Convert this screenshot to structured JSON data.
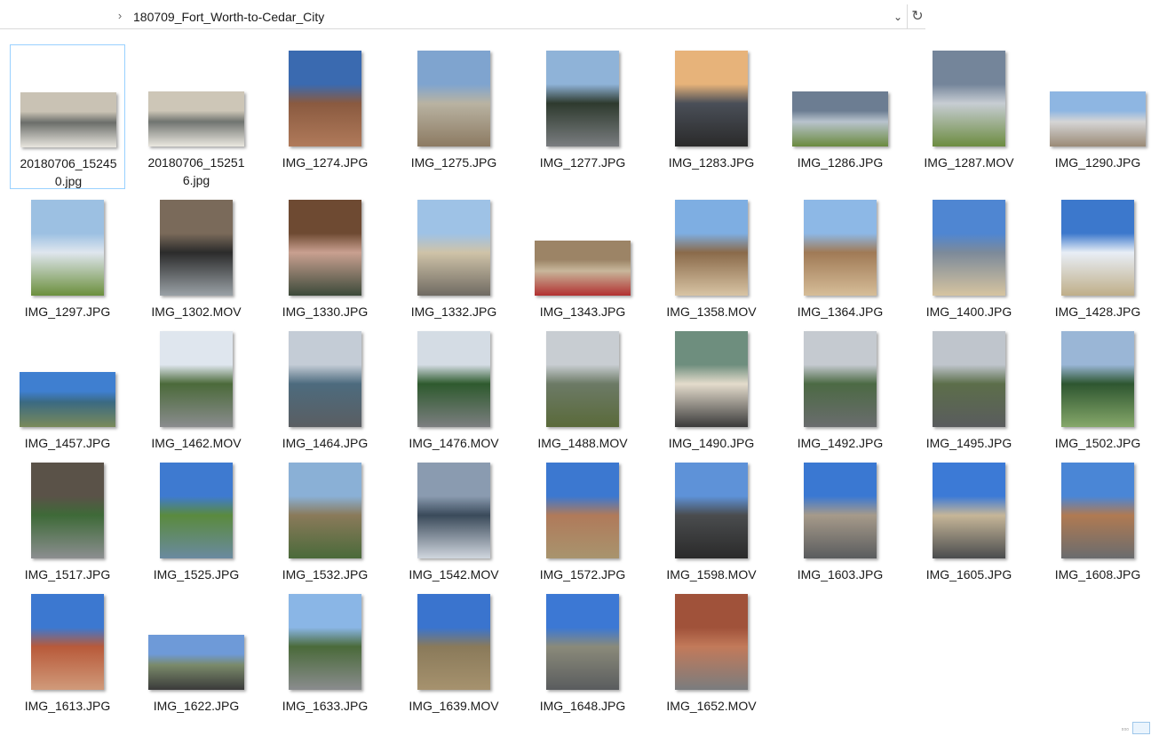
{
  "address_bar": {
    "path": "180709_Fort_Worth-to-Cedar_City",
    "chevron": "›",
    "dropdown": "⌄",
    "refresh": "↻"
  },
  "status": {
    "view_toggle": "▫▫▫"
  },
  "files": [
    {
      "name": "20180706_152450.jpg",
      "orient": "land",
      "colors": [
        "#c9c2b4",
        "#6b6e6a",
        "#e9e6df"
      ]
    },
    {
      "name": "20180706_152516.jpg",
      "orient": "land",
      "colors": [
        "#cdc6b7",
        "#707470",
        "#ebe8e0"
      ]
    },
    {
      "name": "IMG_1274.JPG",
      "orient": "port",
      "colors": [
        "#3a6ab0",
        "#8a5a40",
        "#b07a5a"
      ]
    },
    {
      "name": "IMG_1275.JPG",
      "orient": "port",
      "colors": [
        "#7fa4cf",
        "#b9b3a2",
        "#8c7a62"
      ]
    },
    {
      "name": "IMG_1277.JPG",
      "orient": "port",
      "colors": [
        "#8fb3d8",
        "#2e3a2e",
        "#7a7d80"
      ]
    },
    {
      "name": "IMG_1283.JPG",
      "orient": "port",
      "colors": [
        "#e7b37a",
        "#4a4f58",
        "#2a2a2a"
      ]
    },
    {
      "name": "IMG_1286.JPG",
      "orient": "land",
      "colors": [
        "#6c7d92",
        "#b8c3cd",
        "#6a8a3e"
      ]
    },
    {
      "name": "IMG_1287.MOV",
      "orient": "port",
      "colors": [
        "#74859a",
        "#c7cdd3",
        "#6c8c40"
      ]
    },
    {
      "name": "IMG_1290.JPG",
      "orient": "land",
      "colors": [
        "#8eb6e2",
        "#d5d5d5",
        "#9a8a76"
      ]
    },
    {
      "name": "IMG_1297.JPG",
      "orient": "port",
      "colors": [
        "#9cc0e2",
        "#dfe6ee",
        "#6b8f3c"
      ]
    },
    {
      "name": "IMG_1302.MOV",
      "orient": "port",
      "colors": [
        "#7a6a5a",
        "#2b2b2b",
        "#9aa1a6"
      ]
    },
    {
      "name": "IMG_1330.JPG",
      "orient": "port",
      "colors": [
        "#6e4a32",
        "#c9a090",
        "#3c4a3a"
      ]
    },
    {
      "name": "IMG_1332.JPG",
      "orient": "port",
      "colors": [
        "#9ec2e6",
        "#cfc3a8",
        "#6f6a62"
      ]
    },
    {
      "name": "IMG_1343.JPG",
      "orient": "land",
      "colors": [
        "#9c8466",
        "#c8b79b",
        "#b23030"
      ]
    },
    {
      "name": "IMG_1358.MOV",
      "orient": "port",
      "colors": [
        "#7eaee2",
        "#8a6a4a",
        "#d8c4a4"
      ]
    },
    {
      "name": "IMG_1364.JPG",
      "orient": "port",
      "colors": [
        "#8db8e6",
        "#a07a56",
        "#d6bd98"
      ]
    },
    {
      "name": "IMG_1400.JPG",
      "orient": "port",
      "colors": [
        "#4f86d2",
        "#7c8a9a",
        "#d6c4a0"
      ]
    },
    {
      "name": "IMG_1428.JPG",
      "orient": "port",
      "colors": [
        "#3c78cc",
        "#e8eef6",
        "#bfae88"
      ]
    },
    {
      "name": "IMG_1457.JPG",
      "orient": "land",
      "colors": [
        "#3f7fd0",
        "#3b6a82",
        "#7a8a5a"
      ]
    },
    {
      "name": "IMG_1462.MOV",
      "orient": "port",
      "colors": [
        "#dfe6ee",
        "#4b6a3a",
        "#8a8c8e"
      ]
    },
    {
      "name": "IMG_1464.JPG",
      "orient": "port",
      "colors": [
        "#c4ccd6",
        "#4d6b7e",
        "#5a5e62"
      ]
    },
    {
      "name": "IMG_1476.MOV",
      "orient": "port",
      "colors": [
        "#d4dce4",
        "#2e5a2e",
        "#7c7e80"
      ]
    },
    {
      "name": "IMG_1488.MOV",
      "orient": "port",
      "colors": [
        "#c8cdd2",
        "#6c7a66",
        "#5a6a3a"
      ]
    },
    {
      "name": "IMG_1490.JPG",
      "orient": "port",
      "colors": [
        "#6e8e7e",
        "#e4dccc",
        "#3a3a3a"
      ]
    },
    {
      "name": "IMG_1492.JPG",
      "orient": "port",
      "colors": [
        "#c5cad0",
        "#4c6a44",
        "#6a6c6e"
      ]
    },
    {
      "name": "IMG_1495.JPG",
      "orient": "port",
      "colors": [
        "#bfc5cc",
        "#5c6e4a",
        "#5a5c5e"
      ]
    },
    {
      "name": "IMG_1502.JPG",
      "orient": "port",
      "colors": [
        "#9ab6d6",
        "#2e5630",
        "#86a86a"
      ]
    },
    {
      "name": "IMG_1517.JPG",
      "orient": "port",
      "colors": [
        "#5a5248",
        "#3e6a38",
        "#8c8e90"
      ]
    },
    {
      "name": "IMG_1525.JPG",
      "orient": "port",
      "colors": [
        "#3e7ad0",
        "#5a8a3e",
        "#6a8aa0"
      ]
    },
    {
      "name": "IMG_1532.JPG",
      "orient": "port",
      "colors": [
        "#8ab0d6",
        "#8a7a5a",
        "#4a6a3a"
      ]
    },
    {
      "name": "IMG_1542.MOV",
      "orient": "port",
      "colors": [
        "#8a9bb0",
        "#3a4a5a",
        "#d0d6de"
      ]
    },
    {
      "name": "IMG_1572.JPG",
      "orient": "port",
      "colors": [
        "#3c78d0",
        "#b07a5a",
        "#a8946e"
      ]
    },
    {
      "name": "IMG_1598.MOV",
      "orient": "port",
      "colors": [
        "#5e92d8",
        "#4a4c4e",
        "#2a2a2a"
      ]
    },
    {
      "name": "IMG_1603.JPG",
      "orient": "port",
      "colors": [
        "#3a78d2",
        "#a69a8a",
        "#5a5c5e"
      ]
    },
    {
      "name": "IMG_1605.JPG",
      "orient": "port",
      "colors": [
        "#3c7ad6",
        "#c6b698",
        "#4a4c4e"
      ]
    },
    {
      "name": "IMG_1608.JPG",
      "orient": "port",
      "colors": [
        "#4a86d6",
        "#b07a52",
        "#6a6c6e"
      ]
    },
    {
      "name": "IMG_1613.JPG",
      "orient": "port",
      "colors": [
        "#3c78d0",
        "#b85a3a",
        "#d09a7a"
      ]
    },
    {
      "name": "IMG_1622.JPG",
      "orient": "land",
      "colors": [
        "#6e9ad8",
        "#7a8a6a",
        "#3a3a3a"
      ]
    },
    {
      "name": "IMG_1633.JPG",
      "orient": "port",
      "colors": [
        "#8ab6e6",
        "#4a6a3a",
        "#8a8c8e"
      ]
    },
    {
      "name": "IMG_1639.MOV",
      "orient": "port",
      "colors": [
        "#3a74ce",
        "#8a7a5a",
        "#a6926e"
      ]
    },
    {
      "name": "IMG_1648.JPG",
      "orient": "port",
      "colors": [
        "#3c78d4",
        "#8a8a7a",
        "#5a5c5e"
      ]
    },
    {
      "name": "IMG_1652.MOV",
      "orient": "port",
      "colors": [
        "#a0523a",
        "#c27a5a",
        "#7a7c7e"
      ]
    }
  ]
}
